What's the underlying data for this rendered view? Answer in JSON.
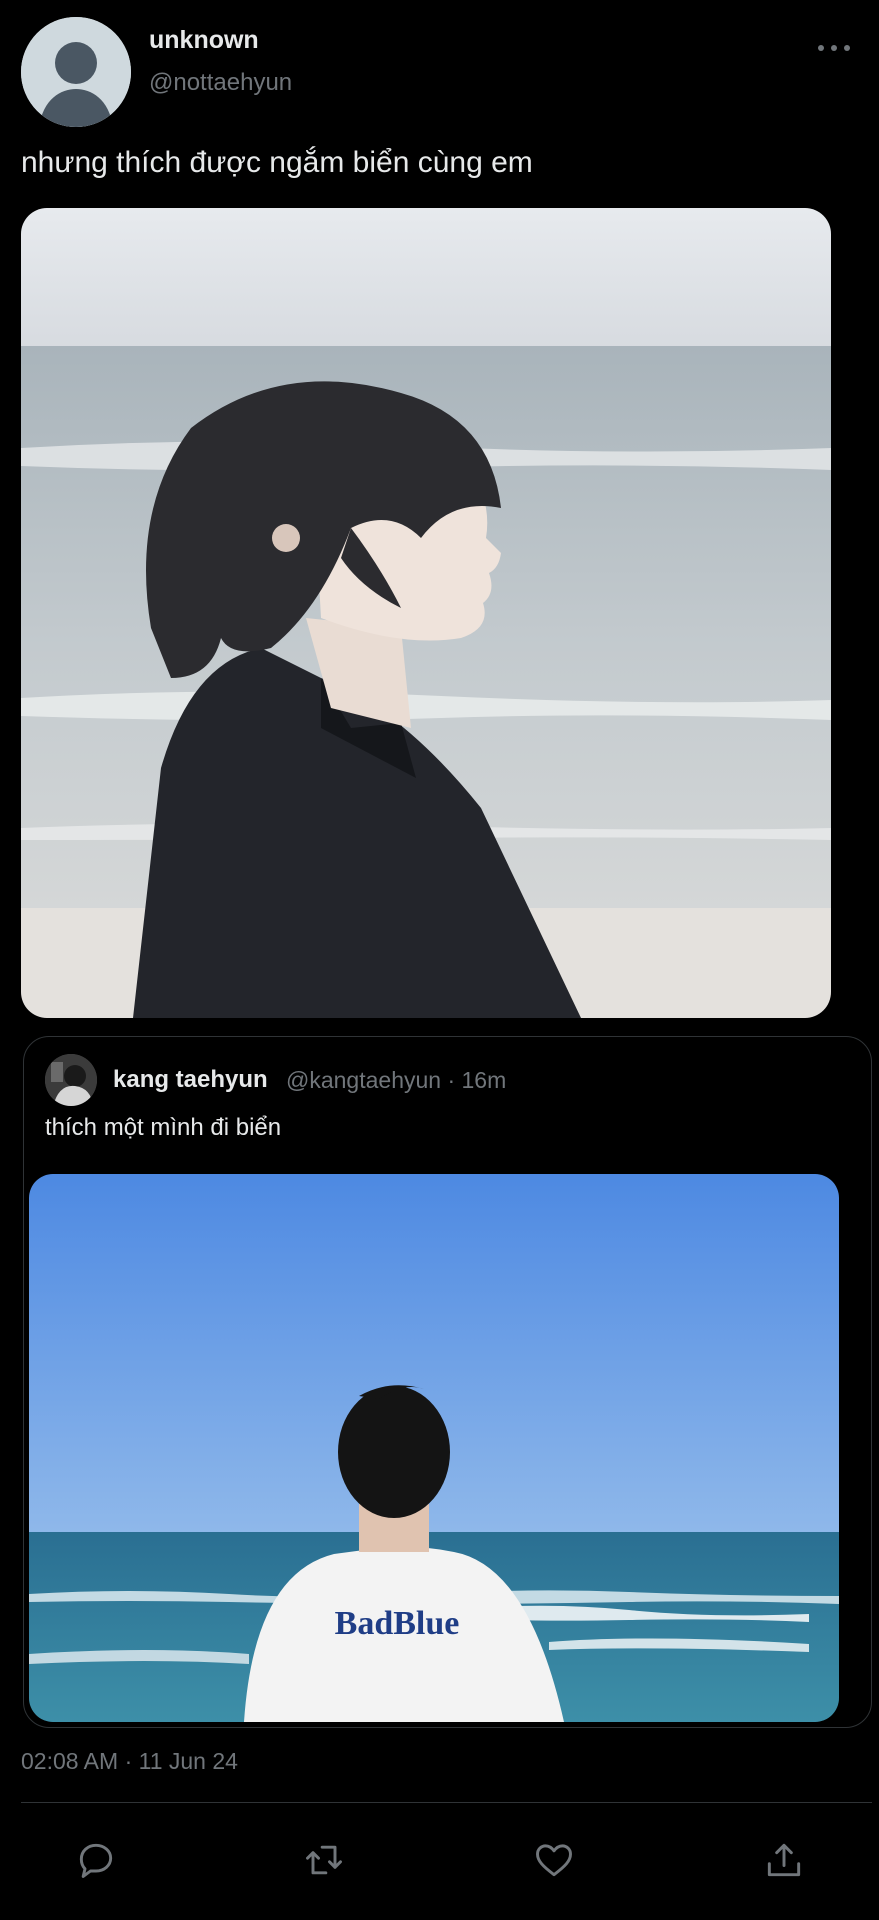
{
  "author": {
    "display_name": "unknown",
    "handle": "@nottaehyun"
  },
  "tweet": {
    "text": "nhưng thích được ngắm biển cùng em"
  },
  "quoted": {
    "display_name": "kang taehyun",
    "meta": "@kangtaehyun · 16m",
    "text": "thích một mình đi biển",
    "shirt_text": "BadBlue"
  },
  "timestamp": "02:08 AM · 11 Jun 24",
  "icons": {
    "more": "more-horizontal-icon",
    "reply": "reply-icon",
    "retweet": "retweet-icon",
    "like": "heart-icon",
    "share": "share-icon"
  },
  "colors": {
    "background": "#000000",
    "primary_text": "#e7e9ea",
    "secondary_text": "#71767b",
    "border": "#2f3336"
  }
}
